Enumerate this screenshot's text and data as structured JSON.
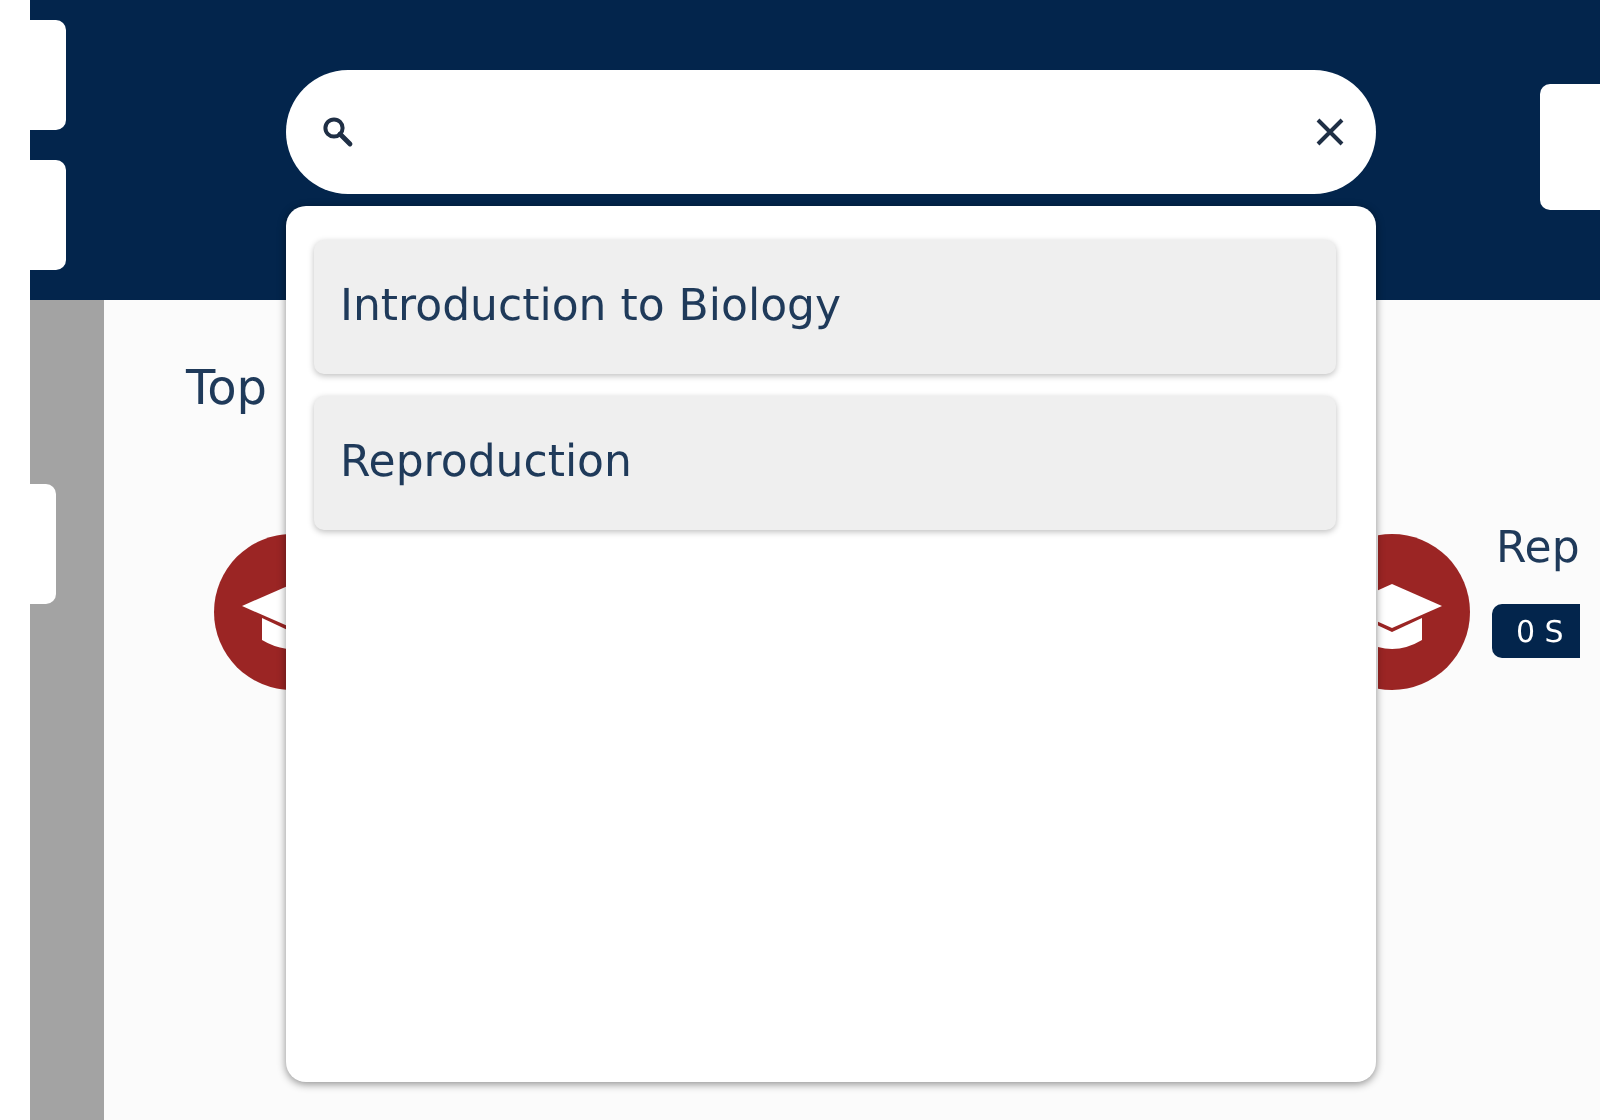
{
  "suggestions": [
    {
      "label": "Introduction to Biology"
    },
    {
      "label": "Reproduction"
    }
  ],
  "content": {
    "heading": "Top",
    "topics": [
      {
        "title": "Rep",
        "badge": "0 S"
      }
    ]
  }
}
